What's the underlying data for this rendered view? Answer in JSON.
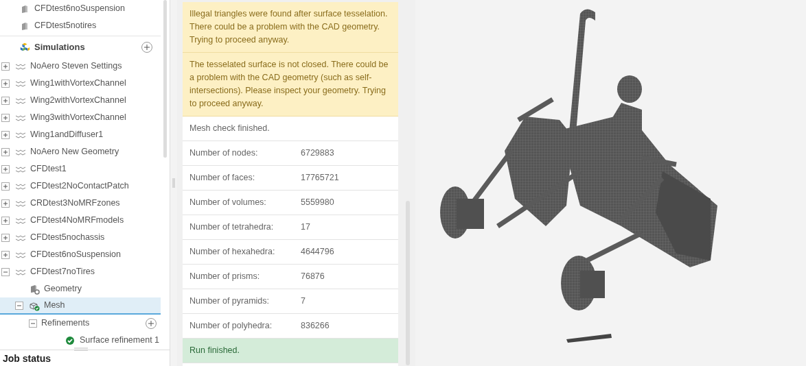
{
  "geometries": [
    {
      "label": "CFDtest6noSuspension"
    },
    {
      "label": "CFDtest5notires"
    }
  ],
  "simulations": {
    "title": "Simulations",
    "items": [
      {
        "label": "NoAero Steven Settings",
        "expanded": false
      },
      {
        "label": "Wing1withVortexChannel",
        "expanded": false
      },
      {
        "label": "Wing2withVortexChannel",
        "expanded": false
      },
      {
        "label": "Wing3withVortexChannel",
        "expanded": false
      },
      {
        "label": "Wing1andDiffuser1",
        "expanded": false
      },
      {
        "label": "NoAero New Geometry",
        "expanded": false
      },
      {
        "label": "CFDtest1",
        "expanded": false
      },
      {
        "label": "CFDtest2NoContactPatch",
        "expanded": false
      },
      {
        "label": "CRDtest3NoMRFzones",
        "expanded": false
      },
      {
        "label": "CFDtest4NoMRFmodels",
        "expanded": false
      },
      {
        "label": "CFDtest5nochassis",
        "expanded": false
      },
      {
        "label": "CFDtest6noSuspension",
        "expanded": false
      },
      {
        "label": "CFDtest7noTires",
        "expanded": true,
        "children": [
          {
            "label": "Geometry",
            "kind": "geometry",
            "selected": false
          },
          {
            "label": "Mesh",
            "kind": "mesh",
            "selected": true,
            "expanded": true,
            "children": [
              {
                "label": "Refinements",
                "kind": "folder",
                "selected": false,
                "expanded": true,
                "children": [
                  {
                    "label": "Surface refinement 1",
                    "kind": "refinement",
                    "selected": false
                  }
                ]
              }
            ]
          }
        ]
      }
    ]
  },
  "job_status": {
    "title": "Job status"
  },
  "log": [
    {
      "kind": "warning",
      "text": "Illegal triangles were found after surface tesselation. There could be a problem with the CAD geometry. Trying to proceed anyway."
    },
    {
      "kind": "warning",
      "text": "The tesselated surface is not closed. There could be a problem with the CAD geometry (such as self-intersections). Please inspect your geometry. Trying to proceed anyway."
    },
    {
      "kind": "info",
      "text": "Mesh check finished."
    },
    {
      "kind": "stat",
      "label": "Number of nodes:",
      "value": "6729883"
    },
    {
      "kind": "stat",
      "label": "Number of faces:",
      "value": "17765721"
    },
    {
      "kind": "stat",
      "label": "Number of volumes:",
      "value": "5559980"
    },
    {
      "kind": "stat",
      "label": "Number of tetrahedra:",
      "value": "17"
    },
    {
      "kind": "stat",
      "label": "Number of hexahedra:",
      "value": "4644796"
    },
    {
      "kind": "stat",
      "label": "Number of prisms:",
      "value": "76876"
    },
    {
      "kind": "stat",
      "label": "Number of pyramids:",
      "value": "7"
    },
    {
      "kind": "stat",
      "label": "Number of polyhedra:",
      "value": "836266"
    },
    {
      "kind": "success",
      "text": "Run finished."
    }
  ]
}
